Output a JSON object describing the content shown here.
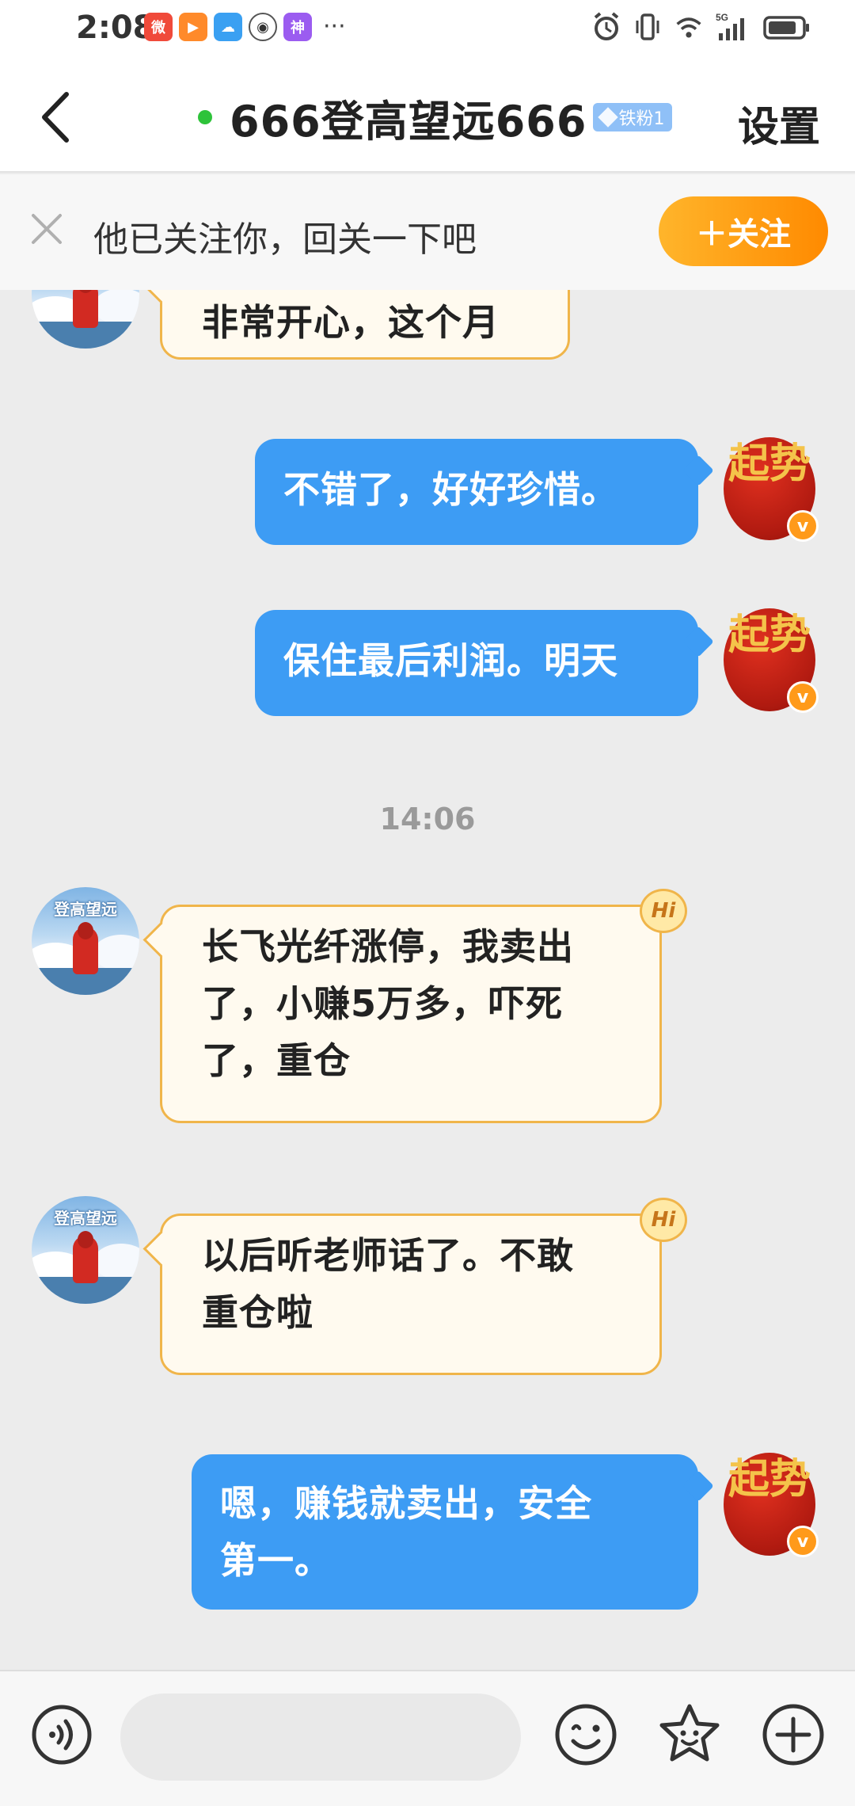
{
  "status_bar": {
    "time": "2:08",
    "apps": [
      {
        "icon": "weibo-icon",
        "label": "微",
        "color": "#f04a3a"
      },
      {
        "icon": "video-play-icon",
        "label": "▶",
        "color": "#ff8a2a"
      },
      {
        "icon": "weather-icon",
        "label": "☁",
        "color": "#3aa0f2"
      },
      {
        "icon": "weibo-outline-icon",
        "label": "◉",
        "color": "#ffffff"
      },
      {
        "icon": "shenmei-app-icon",
        "label": "神",
        "color": "#9b5cf0"
      }
    ],
    "more": "···"
  },
  "header": {
    "title": "666登高望远666",
    "badge": "铁粉1",
    "settings": "设置",
    "online_color": "#2ec33a"
  },
  "follow_bar": {
    "text": "他已关注你，回关一下吧",
    "button": "＋关注"
  },
  "messages": [
    {
      "side": "left",
      "text": "非常开心，这个月",
      "avatar_text": "登高望远"
    },
    {
      "side": "right",
      "text": "不错了，好好珍惜。",
      "avatar_text": "起势"
    },
    {
      "side": "right",
      "text": "保住最后利润。明天",
      "avatar_text": "起势"
    },
    {
      "side": "time",
      "text": "14:06"
    },
    {
      "side": "left",
      "line1": "长飞光纤涨停，我卖出",
      "line2": "了，小赚5万多，吓死",
      "line3": "了，重仓",
      "avatar_text": "登高望远",
      "hi": "Hi"
    },
    {
      "side": "left",
      "line1": "以后听老师话了。不敢",
      "line2": "重仓啦",
      "avatar_text": "登高望远",
      "hi": "Hi"
    },
    {
      "side": "right",
      "line1": "嗯，赚钱就卖出，安全",
      "line2": "第一。",
      "avatar_text": "起势"
    }
  ],
  "verified_badge": "v",
  "colors": {
    "accent_blue": "#3d9cf4",
    "bubble_border": "#f0b54a",
    "follow_orange": "#ff8a00"
  }
}
